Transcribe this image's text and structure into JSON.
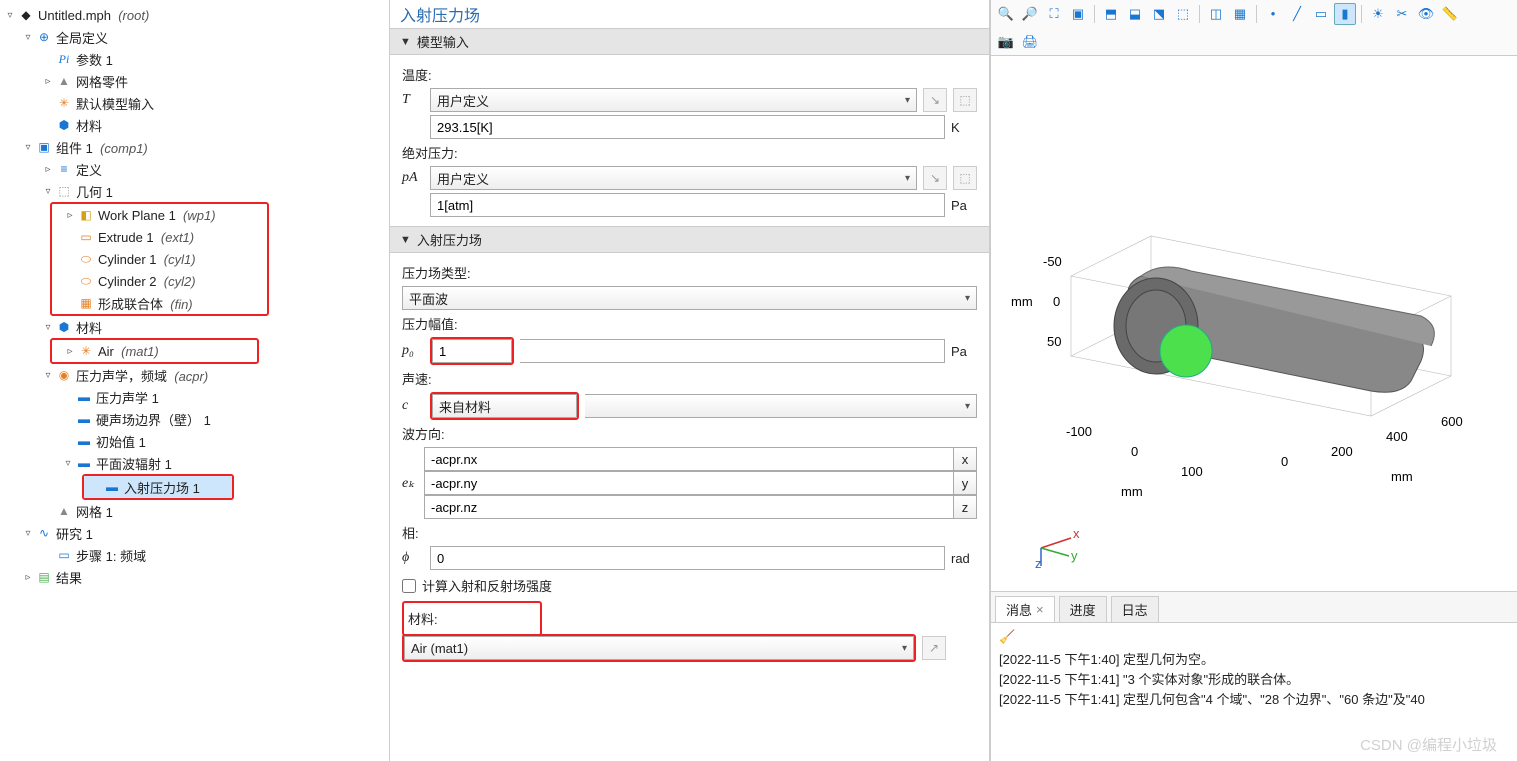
{
  "tree": {
    "root": "Untitled.mph",
    "root_tag": "(root)",
    "global": "全局定义",
    "params": "参数 1",
    "meshparts": "网格零件",
    "defmodel": "默认模型输入",
    "materials_top": "材料",
    "comp": "组件 1",
    "comp_tag": "(comp1)",
    "defs": "定义",
    "geom": "几何 1",
    "wp": "Work Plane 1",
    "wp_tag": "(wp1)",
    "ext": "Extrude 1",
    "ext_tag": "(ext1)",
    "cyl1": "Cylinder 1",
    "cyl1_tag": "(cyl1)",
    "cyl2": "Cylinder 2",
    "cyl2_tag": "(cyl2)",
    "fin": "形成联合体",
    "fin_tag": "(fin)",
    "materials": "材料",
    "air": "Air",
    "air_tag": "(mat1)",
    "acpr": "压力声学，频域",
    "acpr_tag": "(acpr)",
    "acpr1": "压力声学 1",
    "wall": "硬声场边界（壁） 1",
    "init": "初始值 1",
    "pwr": "平面波辐射 1",
    "ipf": "入射压力场 1",
    "mesh": "网格 1",
    "study": "研究 1",
    "step": "步骤 1: 频域",
    "results": "结果"
  },
  "settings": {
    "title": "入射压力场",
    "sec_model": "模型输入",
    "temp_label": "温度:",
    "T_sym": "T",
    "T_sel": "用户定义",
    "T_val": "293.15[K]",
    "T_unit": "K",
    "absP_label": "绝对压力:",
    "pA_sym": "pA",
    "pA_sel": "用户定义",
    "pA_val": "1[atm]",
    "pA_unit": "Pa",
    "sec_ipf": "入射压力场",
    "ftype_label": "压力场类型:",
    "ftype_sel": "平面波",
    "amp_label": "压力幅值:",
    "p0_sym": "p₀",
    "p0_val": "1",
    "p0_unit": "Pa",
    "speed_label": "声速:",
    "c_sym": "c",
    "c_sel": "来自材料",
    "dir_label": "波方向:",
    "ek_sym": "eₖ",
    "ekx": "-acpr.nx",
    "eky": "-acpr.ny",
    "ekz": "-acpr.nz",
    "phase_label": "相:",
    "phi_sym": "ϕ",
    "phi_val": "0",
    "phi_unit": "rad",
    "calc_chk": "计算入射和反射场强度",
    "mat_label": "材料:",
    "mat_sel": "Air (mat1)"
  },
  "gfx": {
    "y_ticks": [
      "-50",
      "0",
      "50"
    ],
    "y_unit": "mm",
    "x_ticks": [
      "-100",
      "0",
      "100"
    ],
    "x_unit": "mm",
    "z_ticks": [
      "0",
      "200",
      "400",
      "600"
    ],
    "z_unit": "mm"
  },
  "msgs": {
    "tab1": "消息",
    "tab2": "进度",
    "tab3": "日志",
    "l1": "[2022-11-5 下午1:40] 定型几何为空。",
    "l2": "[2022-11-5 下午1:41] \"3 个实体对象\"形成的联合体。",
    "l3": "[2022-11-5 下午1:41] 定型几何包含\"4 个域\"、\"28 个边界\"、\"60 条边\"及\"40"
  },
  "watermark": "CSDN @编程小垃圾"
}
